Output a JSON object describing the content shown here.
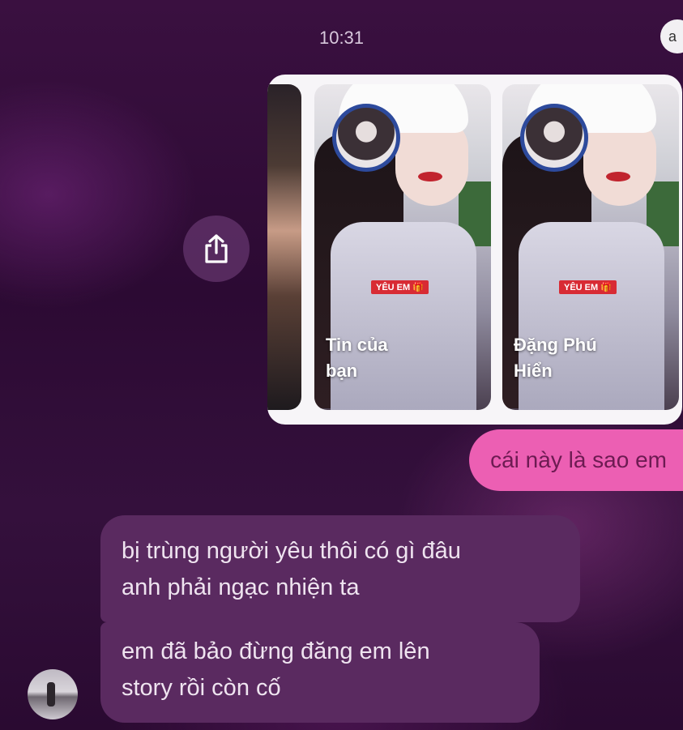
{
  "status_bar": {
    "time": "10:31",
    "corner_glyph": "a"
  },
  "share_button": {
    "icon": "share-icon"
  },
  "stories": [
    {
      "label_line1": "Tin của",
      "label_line2": "bạn",
      "tag": "YÊU EM 🎁"
    },
    {
      "label_line1": "Đặng Phú",
      "label_line2": "Hiển",
      "tag": "YÊU EM 🎁"
    }
  ],
  "messages": {
    "outgoing": "cái này là sao em",
    "incoming": [
      {
        "line1": "bị trùng người yêu thôi có gì đâu",
        "line2": "anh phải ngạc nhiện ta"
      },
      {
        "line1": "em đã bảo đừng đăng em lên",
        "line2": "story rồi còn cố"
      }
    ]
  },
  "colors": {
    "background": "#2c0a33",
    "outgoing_bubble": "#ec5fb3",
    "incoming_bubble": "#5a2a60",
    "story_ring": "#2d4a9c"
  }
}
